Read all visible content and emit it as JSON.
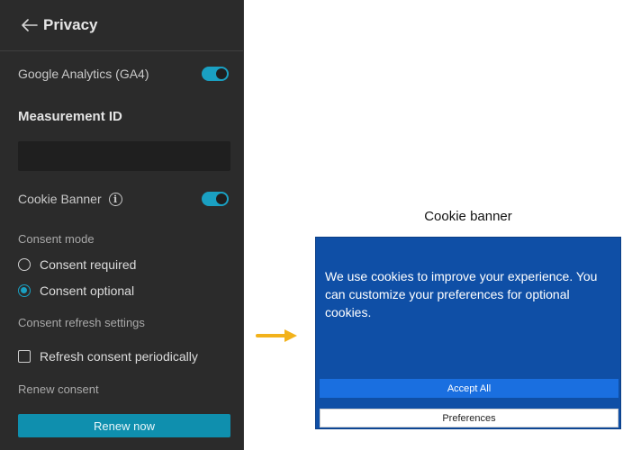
{
  "panel": {
    "title": "Privacy",
    "google_analytics": {
      "label": "Google Analytics (GA4)",
      "enabled": true
    },
    "measurement_id": {
      "label": "Measurement ID",
      "value": "",
      "placeholder": ""
    },
    "cookie_banner": {
      "label": "Cookie Banner",
      "enabled": true
    },
    "consent_mode": {
      "label": "Consent mode",
      "options": [
        {
          "label": "Consent required",
          "selected": false
        },
        {
          "label": "Consent optional",
          "selected": true
        }
      ]
    },
    "consent_refresh": {
      "label": "Consent refresh settings",
      "checkbox_label": "Refresh consent periodically",
      "checked": false
    },
    "renew": {
      "label": "Renew consent",
      "button_label": "Renew now"
    }
  },
  "preview": {
    "title": "Cookie banner",
    "message": "We use cookies to improve your experience. You can customize your preferences for optional cookies.",
    "accept_label": "Accept All",
    "preferences_label": "Preferences"
  },
  "colors": {
    "panel_bg": "#2b2b2b",
    "accent": "#1aa0c2",
    "banner_bg": "#0f4fa6",
    "accept_bg": "#1a6fe0",
    "arrow": "#f2b21b"
  },
  "icons": [
    "back-arrow-icon",
    "info-icon",
    "right-arrow-icon"
  ]
}
